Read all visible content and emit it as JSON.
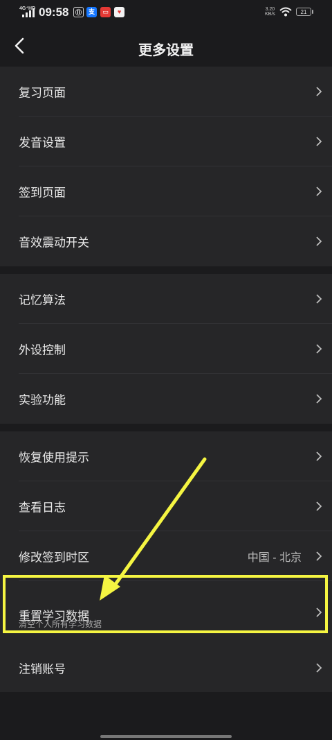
{
  "status_bar": {
    "network": "4G⁺HD",
    "time": "09:58",
    "speed_value": "3.20",
    "speed_unit": "KB/s",
    "battery": "21",
    "app_icons": [
      {
        "name": "unicom-app-icon",
        "glyph": "⑪",
        "color": "#2a2a2c"
      },
      {
        "name": "alipay-app-icon",
        "glyph": "支",
        "color": "#1677ff"
      },
      {
        "name": "app-red-icon",
        "glyph": "▭",
        "color": "#e53935"
      },
      {
        "name": "app-map-icon",
        "glyph": "♥",
        "color": "#f2f2f2"
      }
    ]
  },
  "header": {
    "title": "更多设置",
    "back_icon": "chevron-left-icon"
  },
  "groups": [
    {
      "items": [
        {
          "label": "复习页面"
        },
        {
          "label": "发音设置"
        },
        {
          "label": "签到页面"
        },
        {
          "label": "音效震动开关"
        }
      ]
    },
    {
      "items": [
        {
          "label": "记忆算法"
        },
        {
          "label": "外设控制"
        },
        {
          "label": "实验功能"
        }
      ]
    },
    {
      "items": [
        {
          "label": "恢复使用提示"
        },
        {
          "label": "查看日志"
        },
        {
          "label": "修改签到时区",
          "value": "中国 - 北京"
        },
        {
          "label": "重置学习数据",
          "sub": "清空个人所有学习数据",
          "highlighted": true
        },
        {
          "label": "注销账号"
        }
      ]
    }
  ],
  "colors": {
    "background": "#1b1b1d",
    "card": "#262628",
    "annotation": "#f5f542"
  }
}
